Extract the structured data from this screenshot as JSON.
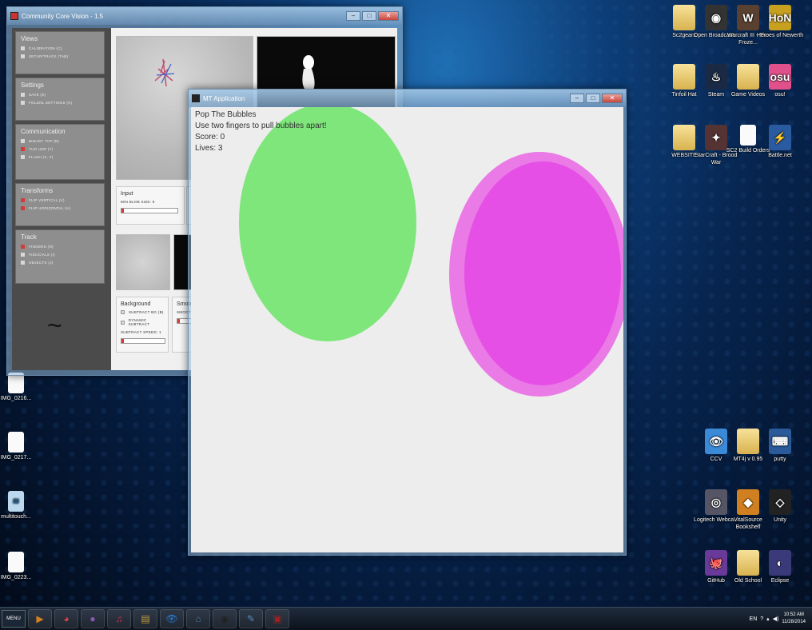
{
  "desktop": {
    "icons_right": [
      {
        "label": "Sc2gears",
        "glyph": "folder"
      },
      {
        "label": "Open Broadcast...",
        "glyph": "obs"
      },
      {
        "label": "Warcraft III - The Froze...",
        "glyph": "wc3"
      },
      {
        "label": "Heroes of Newerth",
        "glyph": "hon"
      },
      {
        "label": "Tinfoil Hat",
        "glyph": "folder"
      },
      {
        "label": "Steam",
        "glyph": "steam"
      },
      {
        "label": "Game Videos",
        "glyph": "folder"
      },
      {
        "label": "osu!",
        "glyph": "osu"
      },
      {
        "label": "WEBSITE",
        "glyph": "folder"
      },
      {
        "label": "StarCraft - Brood War",
        "glyph": "sc"
      },
      {
        "label": "SC2 Build Orders",
        "glyph": "file"
      },
      {
        "label": "Battle.net",
        "glyph": "bnet"
      },
      {
        "label": "CCV",
        "glyph": "ccv"
      },
      {
        "label": "MT4j v 0.95",
        "glyph": "folder"
      },
      {
        "label": "putty",
        "glyph": "putty"
      },
      {
        "label": "Logitech Webca...",
        "glyph": "logitech"
      },
      {
        "label": "VitalSource Bookshelf",
        "glyph": "vital"
      },
      {
        "label": "Unity",
        "glyph": "unity"
      },
      {
        "label": "GitHub",
        "glyph": "github"
      },
      {
        "label": "Old School",
        "glyph": "folder"
      },
      {
        "label": "Eclipse",
        "glyph": "eclipse"
      }
    ],
    "icons_left": [
      {
        "label": "IMG_0216..."
      },
      {
        "label": "IMG_0217..."
      },
      {
        "label": "multitouch..."
      },
      {
        "label": "IMG_0223..."
      }
    ]
  },
  "ccv_window": {
    "title": "Community Core Vision - 1.5",
    "panels": [
      {
        "title": "Views",
        "options": [
          {
            "label": "CALIBRATION (C)",
            "checked": false
          },
          {
            "label": "SETUP/TRACK (TAB)",
            "checked": false
          }
        ]
      },
      {
        "title": "Settings",
        "options": [
          {
            "label": "SAVE (S)",
            "checked": false
          },
          {
            "label": "FOLDNL SETTINGS (K)",
            "checked": false
          }
        ]
      },
      {
        "title": "Communication",
        "options": [
          {
            "label": "BINARY TCP (B)",
            "checked": false
          },
          {
            "label": "TUO UDP (T)",
            "checked": true
          },
          {
            "label": "FLASH (X, F)",
            "checked": false
          }
        ]
      },
      {
        "title": "Transforms",
        "options": [
          {
            "label": "FLIP VERTICAL (V)",
            "checked": true
          },
          {
            "label": "FLIP HORIZONTAL (H)",
            "checked": true
          }
        ]
      },
      {
        "title": "Track",
        "options": [
          {
            "label": "FINGERS (N)",
            "checked": true
          },
          {
            "label": "FIDUCIALS (I)",
            "checked": false
          },
          {
            "label": "OBJECTS (J)",
            "checked": false
          }
        ]
      }
    ],
    "input_group": {
      "title": "Input",
      "slider_label": "MIN BLOB SIZE: 9"
    },
    "background_group": {
      "title": "Background",
      "options": [
        {
          "label": "SUBTRACT BG (B)",
          "checked": false
        },
        {
          "label": "DYNAMIC SUBTRACT",
          "checked": false
        }
      ],
      "slider_label": "SUBTRACT SPEED: 1"
    },
    "smooth_group": {
      "title": "Smoo",
      "label": "SMOOT"
    }
  },
  "mt_window": {
    "title": "MT Application",
    "hud": {
      "title": "Pop The Bubbles",
      "instructions": "Use two fingers to pull bubbles apart!",
      "score": "Score: 0",
      "lives": "Lives: 3"
    },
    "bubble_colors": {
      "green": "#7ee67a",
      "magenta_outer": "#ea7ae6",
      "magenta_inner": "#e64fe6"
    }
  },
  "taskbar": {
    "start_label": "MENU",
    "apps": [
      "media-player",
      "chrome",
      "orb",
      "itunes",
      "explorer",
      "ccv-eye",
      "network",
      "obs",
      "notes",
      "stream"
    ],
    "tray": {
      "lang": "EN",
      "time": "10:52 AM",
      "date": "11/28/2014"
    }
  }
}
